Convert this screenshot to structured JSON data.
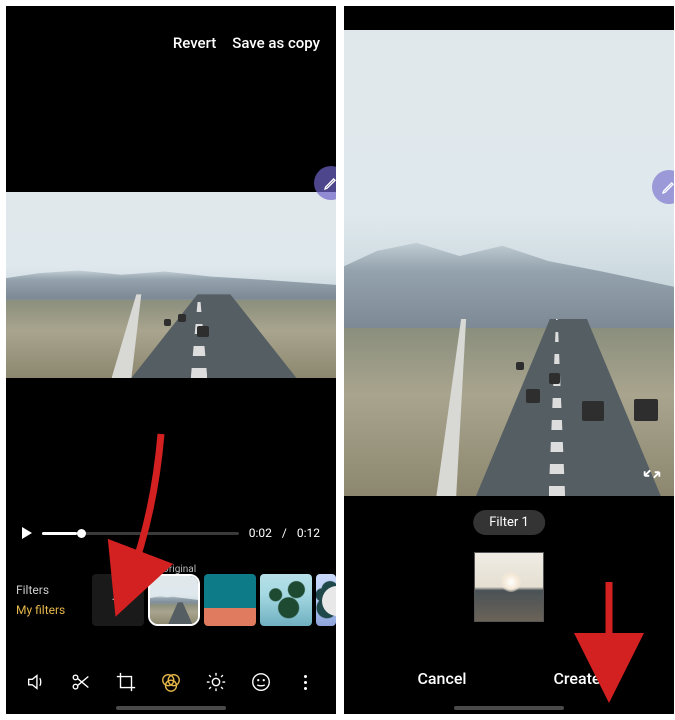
{
  "left": {
    "actions": {
      "revert": "Revert",
      "save_copy": "Save as copy"
    },
    "playback": {
      "pos": "0:02",
      "dur": "0:12"
    },
    "filters": {
      "tab_all": "Filters",
      "tab_mine": "My filters",
      "original_label": "Original"
    },
    "tools": {
      "speaker": "speaker",
      "cut": "cut",
      "crop": "crop",
      "filter": "filter",
      "brightness": "brightness",
      "emoji": "emoji",
      "more": "more"
    }
  },
  "right": {
    "filter_name": "Filter 1",
    "actions": {
      "cancel": "Cancel",
      "create": "Create"
    }
  }
}
